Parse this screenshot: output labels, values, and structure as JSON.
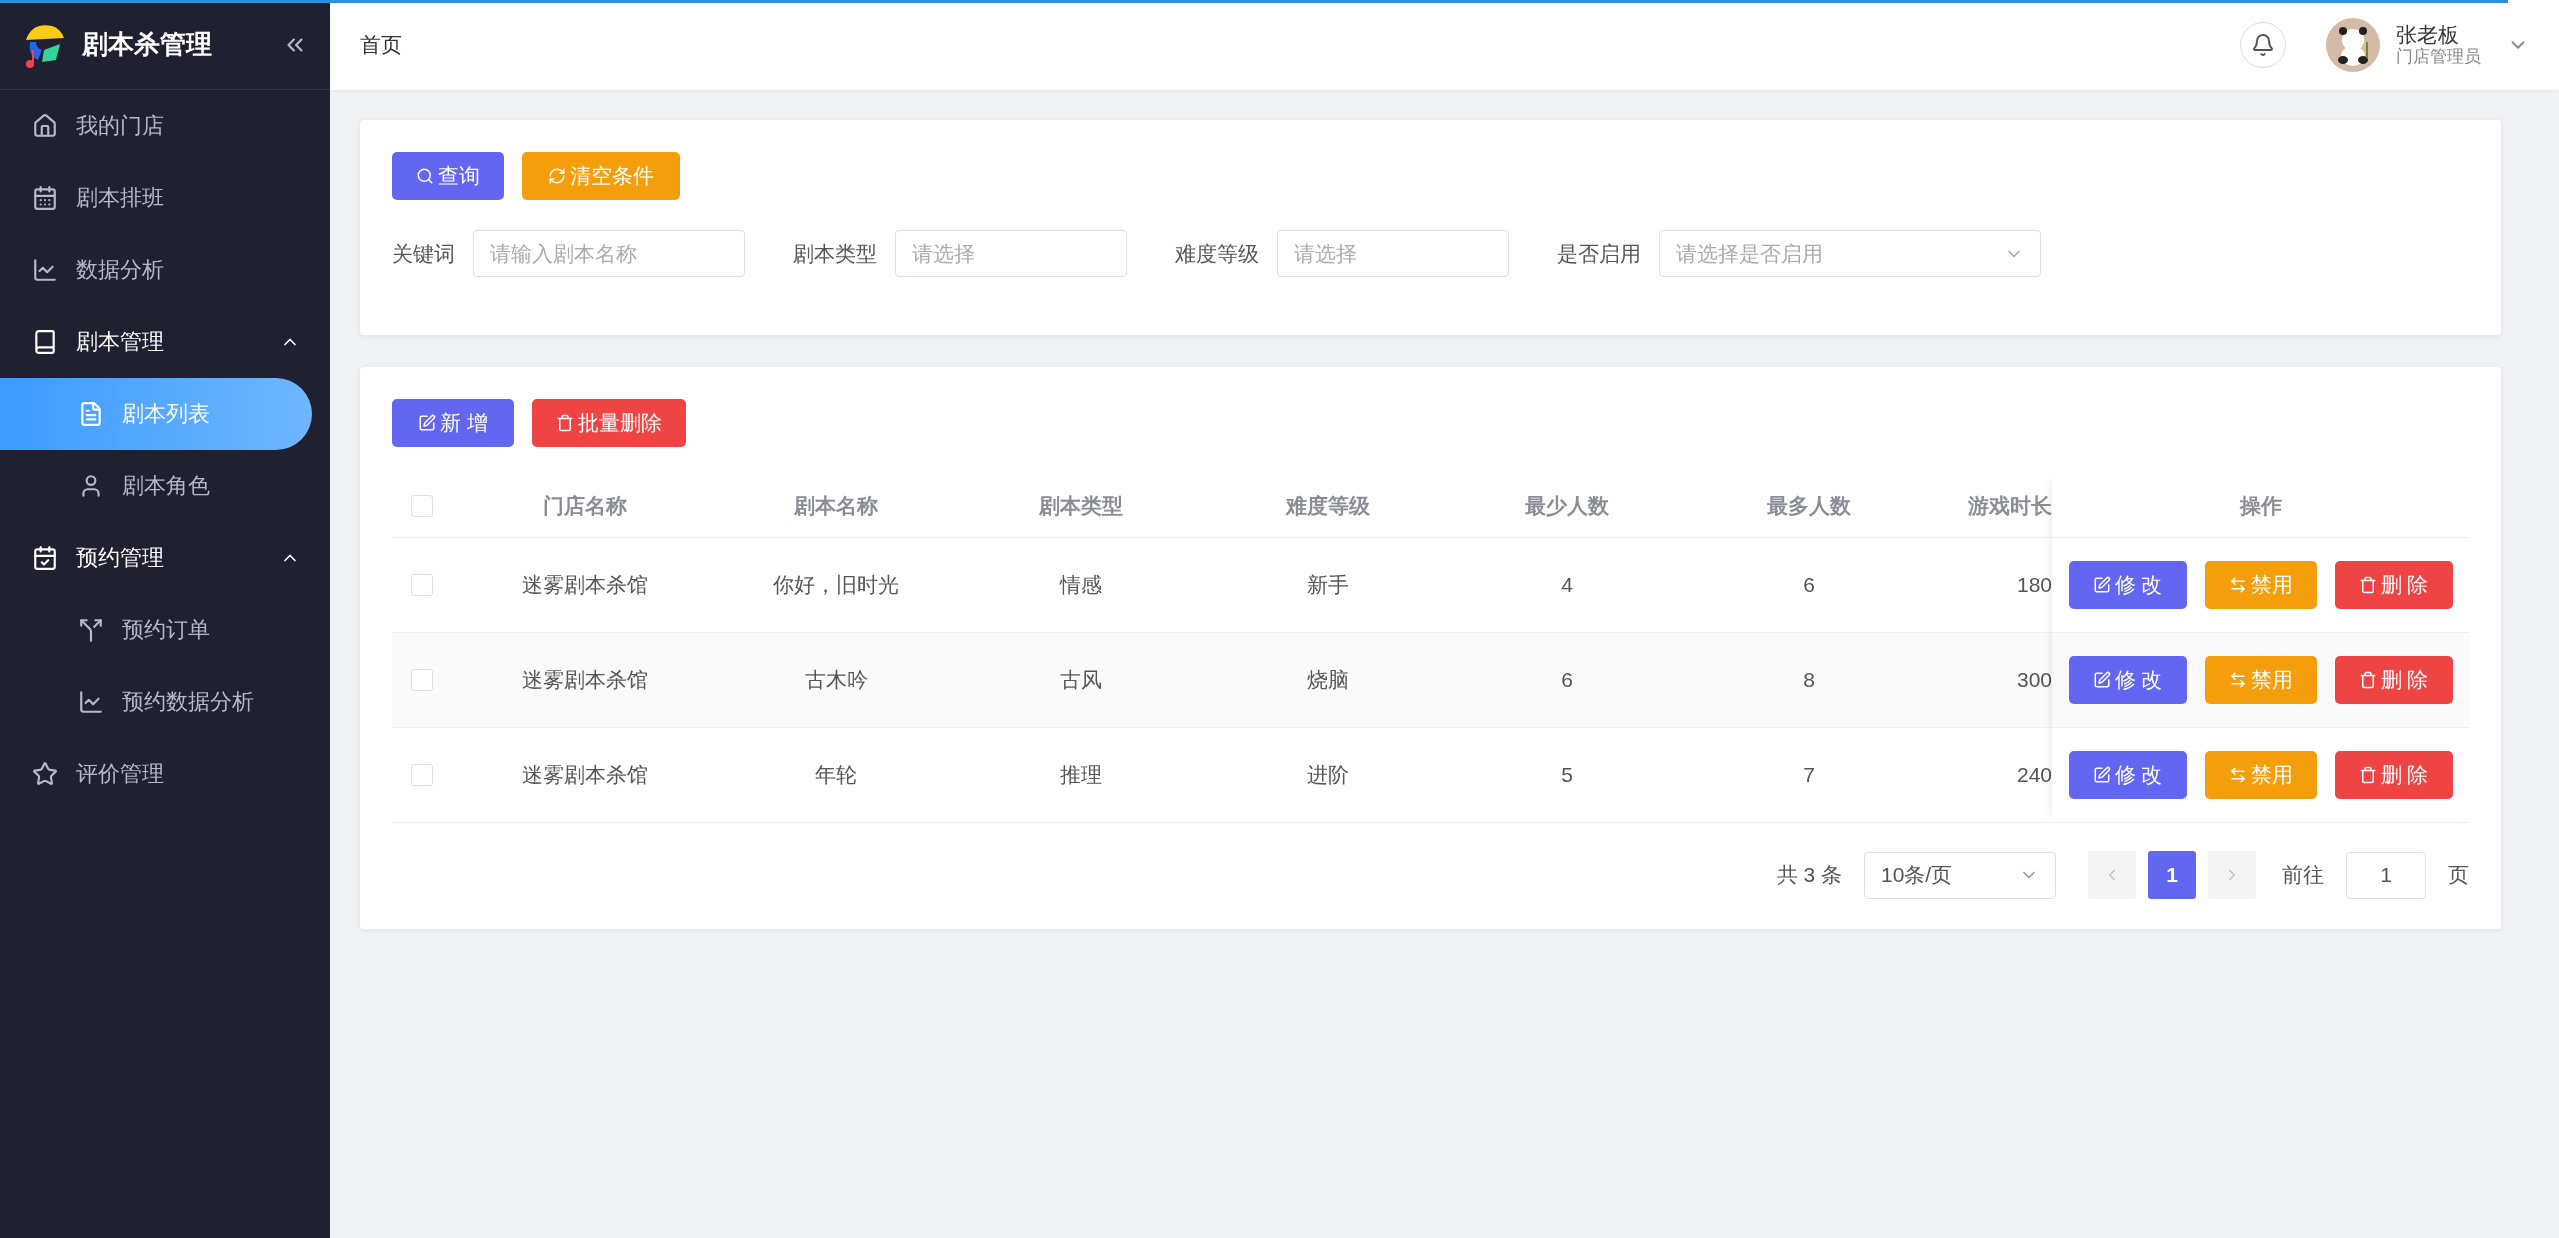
{
  "loading_bar": {
    "level": 0.98
  },
  "sidebar": {
    "title": "剧本杀管理",
    "menu": [
      {
        "label": "我的门店",
        "selected": false
      },
      {
        "label": "剧本排班",
        "selected": false
      },
      {
        "label": "数据分析",
        "selected": false
      },
      {
        "label": "剧本管理",
        "selected": false,
        "expanded": true,
        "children": [
          {
            "label": "剧本列表",
            "selected": true
          },
          {
            "label": "剧本角色",
            "selected": false
          }
        ]
      },
      {
        "label": "预约管理",
        "selected": false,
        "expanded": true,
        "children": [
          {
            "label": "预约订单",
            "selected": false
          },
          {
            "label": "预约数据分析",
            "selected": false
          }
        ]
      },
      {
        "label": "评价管理",
        "selected": false
      }
    ]
  },
  "header": {
    "breadcrumb": "首页",
    "user": {
      "name": "张老板",
      "role": "门店管理员"
    }
  },
  "filter": {
    "buttons": [
      {
        "kind": "search",
        "label": "查询"
      },
      {
        "kind": "reset",
        "label": "清空条件"
      }
    ],
    "fields": [
      {
        "kind": "input",
        "label": "关键词",
        "placeholder": "请输入剧本名称"
      },
      {
        "kind": "input",
        "label": "剧本类型",
        "placeholder": "请选择"
      },
      {
        "kind": "input",
        "label": "难度等级",
        "placeholder": "请选择"
      },
      {
        "kind": "select",
        "label": "是否启用",
        "placeholder": "请选择是否启用"
      }
    ]
  },
  "table": {
    "buttons": [
      {
        "kind": "add",
        "label": "新 增"
      },
      {
        "kind": "delete",
        "label": "批量删除"
      }
    ],
    "header_checked": false,
    "columns": [
      "门店名称",
      "剧本名称",
      "剧本类型",
      "难度等级",
      "最少人数",
      "最多人数",
      "游戏时长"
    ],
    "action_column": "操作",
    "rows": [
      {
        "checked": false,
        "cells": [
          "迷雾剧本杀馆",
          "你好，旧时光",
          "情感",
          "新手",
          "4",
          "6",
          "180"
        ],
        "actions": [
          {
            "kind": "edit",
            "label": "修 改"
          },
          {
            "kind": "disable",
            "label": "禁用"
          },
          {
            "kind": "delete",
            "label": "删 除"
          }
        ]
      },
      {
        "checked": false,
        "cells": [
          "迷雾剧本杀馆",
          "古木吟",
          "古风",
          "烧脑",
          "6",
          "8",
          "300"
        ],
        "actions": [
          {
            "kind": "edit",
            "label": "修 改"
          },
          {
            "kind": "disable",
            "label": "禁用"
          },
          {
            "kind": "delete",
            "label": "删 除"
          }
        ]
      },
      {
        "checked": false,
        "cells": [
          "迷雾剧本杀馆",
          "年轮",
          "推理",
          "进阶",
          "5",
          "7",
          "240"
        ],
        "actions": [
          {
            "kind": "edit",
            "label": "修 改"
          },
          {
            "kind": "disable",
            "label": "禁用"
          },
          {
            "kind": "delete",
            "label": "删 除"
          }
        ]
      }
    ]
  },
  "pagination": {
    "total": "共 3 条",
    "page_size": "10条/页",
    "prev_disabled": true,
    "next_disabled": true,
    "pages": [
      {
        "label": "1",
        "selected": true
      }
    ],
    "goto_label": "前往",
    "goto_value": "1",
    "goto_suffix": "页"
  }
}
